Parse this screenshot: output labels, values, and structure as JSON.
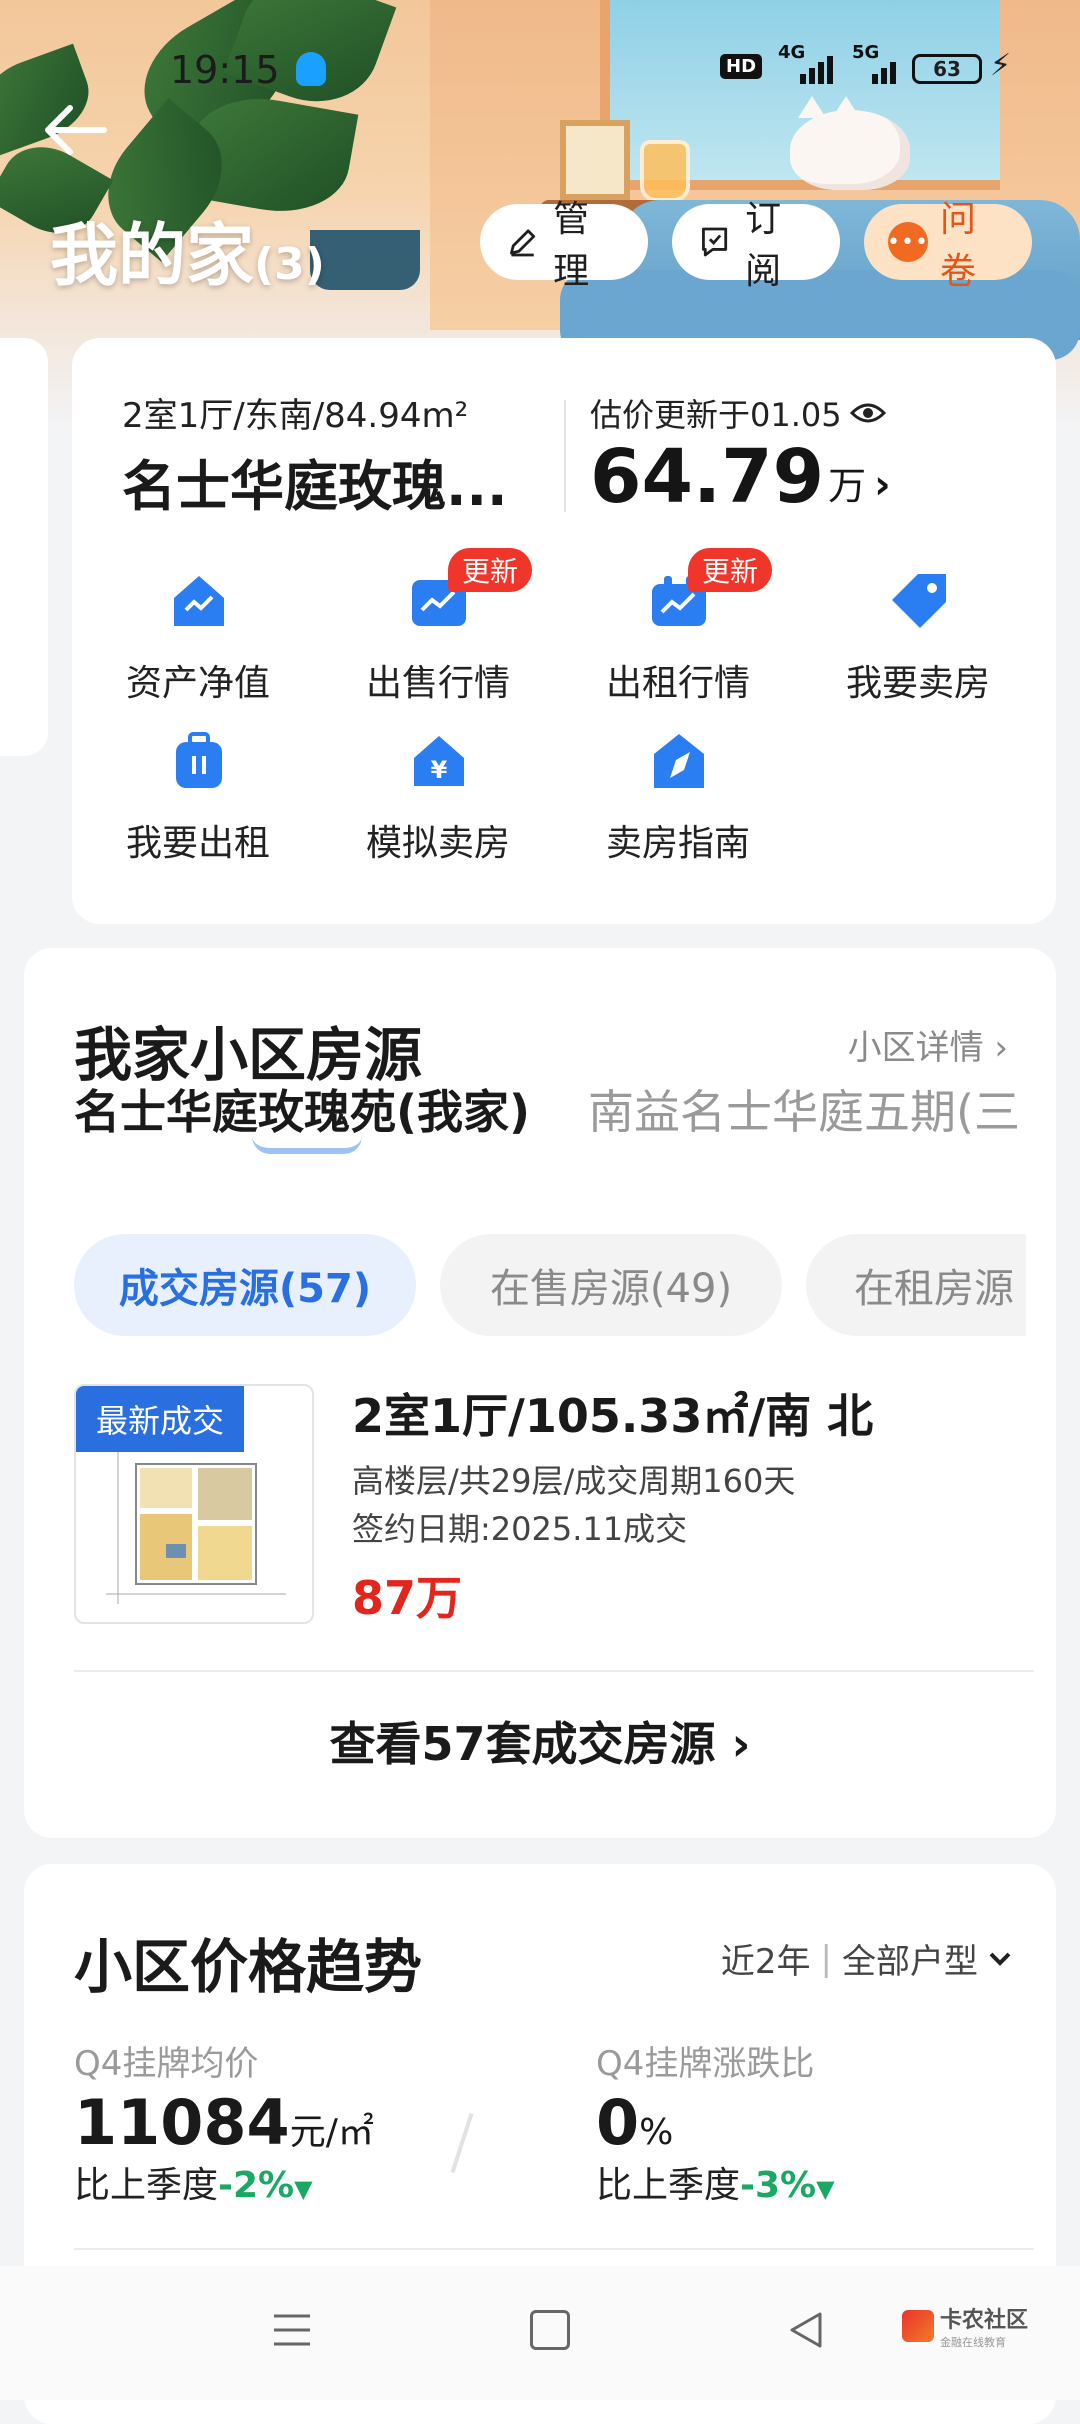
{
  "status": {
    "time": "19:15",
    "hd": "HD",
    "network_1": "4G",
    "network_2": "5G",
    "battery": "63"
  },
  "header": {
    "title": "我的家",
    "count": "(3)",
    "manage_label": "管理",
    "subscribe_label": "订阅",
    "questionnaire_label": "问卷"
  },
  "home": {
    "spec": "2室1厅/东南/84.94m²",
    "estate": "名士华庭玫瑰...",
    "valuation_label": "估价更新于01.05",
    "price": "64.79",
    "price_unit": "万",
    "features": [
      {
        "label": "资产净值",
        "badge": ""
      },
      {
        "label": "出售行情",
        "badge": "更新"
      },
      {
        "label": "出租行情",
        "badge": "更新"
      },
      {
        "label": "我要卖房",
        "badge": ""
      },
      {
        "label": "我要出租",
        "badge": ""
      },
      {
        "label": "模拟卖房",
        "badge": ""
      },
      {
        "label": "卖房指南",
        "badge": ""
      }
    ]
  },
  "neighborhood": {
    "title": "我家小区房源",
    "detail_link": "小区详情",
    "estate_tabs": [
      "名士华庭玫瑰苑(我家)",
      "南益名士华庭五期(三"
    ],
    "chips": [
      "成交房源(57)",
      "在售房源(49)",
      "在租房源"
    ],
    "listing": {
      "tag": "最新成交",
      "title": "2室1厅/105.33㎡/南 北",
      "meta1": "高楼层/共29层/成交周期160天",
      "meta2": "签约日期:2025.11成交",
      "price": "87万"
    },
    "view_all": "查看57套成交房源"
  },
  "trend": {
    "title": "小区价格趋势",
    "period": "近2年",
    "type_filter": "全部户型",
    "avg_label": "Q4挂牌均价",
    "avg_value": "11084",
    "avg_unit": "元/㎡",
    "avg_cmp_label": "比上季度",
    "avg_cmp_value": "-2%",
    "ratio_label": "Q4挂牌涨跌比",
    "ratio_value": "0",
    "ratio_unit": "%",
    "ratio_cmp_label": "比上季度",
    "ratio_cmp_value": "-3%"
  },
  "watermark": {
    "name": "卡农社区",
    "sub": "金融在线教育"
  },
  "colors": {
    "accent_blue": "#2a6fe0",
    "price_red": "#e2261d",
    "badge_red": "#f0352b",
    "decrease_green": "#1aa864",
    "questionnaire_orange": "#f06a21"
  }
}
